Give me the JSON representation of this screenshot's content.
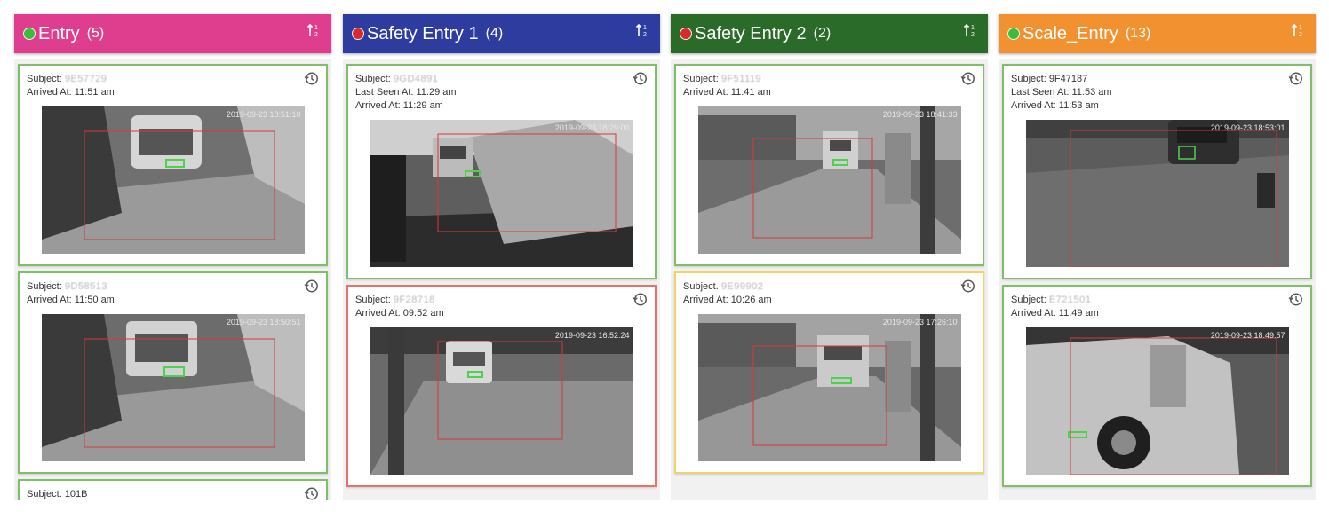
{
  "columns": [
    {
      "title": "Entry",
      "count": "(5)",
      "header_color": "#df3e8f",
      "status": "green",
      "cards": [
        {
          "subject_label": "Subject:",
          "subject_value": "9E57729",
          "line1": "Arrived At: 11:51 am",
          "line2": "",
          "timestamp": "2019-09-23 18:51:10",
          "border": "green",
          "scene": "truck-front-close"
        },
        {
          "subject_label": "Subject:",
          "subject_value": "9D58513",
          "line1": "Arrived At: 11:50 am",
          "line2": "",
          "timestamp": "2019-09-23 18:50:51",
          "border": "green",
          "scene": "truck-front-close"
        },
        {
          "subject_label": "Subject:",
          "subject_value": "101B",
          "line1": "",
          "line2": "",
          "timestamp": "",
          "border": "green",
          "scene": "none"
        }
      ]
    },
    {
      "title": "Safety Entry 1",
      "count": "(4)",
      "header_color": "#2f3c9f",
      "status": "red",
      "cards": [
        {
          "subject_label": "Subject:",
          "subject_value": "9GD4891",
          "line1": "Last Seen At: 11:29 am",
          "line2": "Arrived At: 11:29 am",
          "timestamp": "2019-09-23 18:29:00",
          "border": "green",
          "scene": "mixer-truck"
        },
        {
          "subject_label": "Subject:",
          "subject_value": "9F28718",
          "line1": "Arrived At: 09:52 am",
          "line2": "",
          "timestamp": "2019-09-23 16:52:24",
          "border": "red",
          "scene": "road-truck"
        }
      ]
    },
    {
      "title": "Safety Entry 2",
      "count": "(2)",
      "header_color": "#2a6b2a",
      "status": "red",
      "cards": [
        {
          "subject_label": "Subject:",
          "subject_value": "9F51119",
          "line1": "Arrived At: 11:41 am",
          "line2": "",
          "timestamp": "2019-09-23 18:41:33",
          "border": "green",
          "scene": "yard-truck"
        },
        {
          "subject_label": "Subject.",
          "subject_value": "9E99902",
          "line1": "Arrived At: 10:26 am",
          "line2": "",
          "timestamp": "2019-09-23 17:26:10",
          "border": "yellow",
          "scene": "yard-truck"
        }
      ]
    },
    {
      "title": "Scale_Entry",
      "count": "(13)",
      "header_color": "#f2912f",
      "status": "green",
      "cards": [
        {
          "subject_label": "Subject:",
          "subject_value": "9F47187",
          "line1": "Last Seen At: 11:53 am",
          "line2": "Arrived At: 11:53 am",
          "timestamp": "2019-09-23 18:53:01",
          "border": "green",
          "scene": "scale-road"
        },
        {
          "subject_label": "Subject:",
          "subject_value": "E721501",
          "line1": "Arrived At: 11:49 am",
          "line2": "",
          "timestamp": "2019-09-23 18:49:57",
          "border": "green",
          "scene": "scale-truck-close"
        }
      ]
    }
  ],
  "icons": {
    "sort": "sort-icon",
    "history": "history-icon",
    "status": "status-dot"
  },
  "colors": {
    "status_green": "#3dbb3d",
    "status_red": "#d62b2b",
    "border_green": "#7fbf6a",
    "border_red": "#e7716d",
    "border_yellow": "#f1d36a"
  }
}
